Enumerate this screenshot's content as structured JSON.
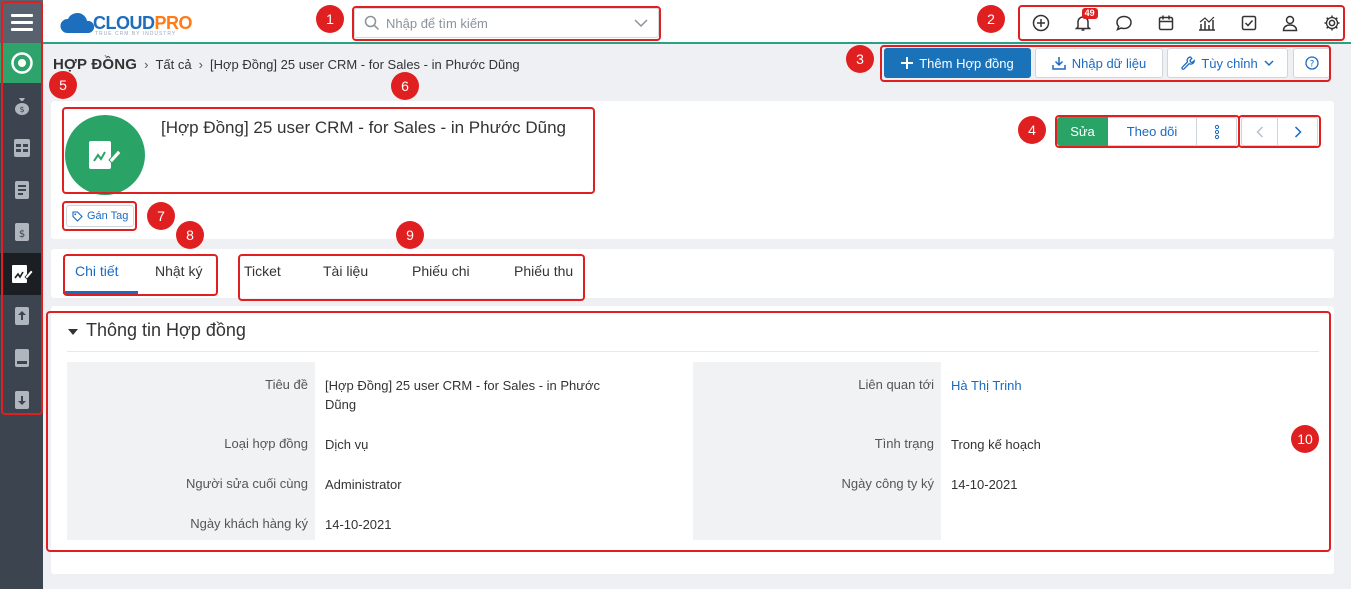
{
  "app": {
    "logo_main": "CLOUD",
    "logo_accent": "PRO",
    "logo_tagline": "TRUE CRM BY INDUSTRY"
  },
  "search": {
    "placeholder": "Nhập để tìm kiếm"
  },
  "notifications": {
    "count": "49"
  },
  "top_icons": [
    "plus-circle-icon",
    "bell-icon",
    "chat-icon",
    "calendar-icon",
    "chart-icon",
    "checkbox-icon",
    "user-icon",
    "gear-icon"
  ],
  "sidebar": {
    "icons": [
      "menu-icon",
      "home-icon",
      "money-bag-icon",
      "spreadsheet-icon",
      "document-icon",
      "invoice-icon",
      "contract-icon",
      "upload-icon",
      "book-icon",
      "download-icon"
    ],
    "active": "contract-icon"
  },
  "breadcrumb": {
    "module": "HỢP ĐỒNG",
    "all": "Tất cả",
    "record": "[Hợp Đồng] 25 user CRM - for Sales - in Phước Dũng"
  },
  "toolbar": {
    "add_label": "Thêm Hợp đồng",
    "import_label": "Nhập dữ liệu",
    "customize_label": "Tùy chỉnh"
  },
  "record": {
    "title": "[Hợp Đồng] 25 user CRM - for Sales - in Phước Dũng",
    "tag_label": "Gán Tag",
    "edit_label": "Sửa",
    "follow_label": "Theo dõi"
  },
  "tabs": {
    "group1": [
      "Chi tiết",
      "Nhật ký"
    ],
    "group2": [
      "Ticket",
      "Tài liệu",
      "Phiếu chi",
      "Phiếu thu"
    ],
    "active": "Chi tiết"
  },
  "details": {
    "section_title": "Thông tin Hợp đồng",
    "left": [
      {
        "label": "Tiêu đề",
        "value": "[Hợp Đồng] 25 user CRM - for Sales - in Phước Dũng"
      },
      {
        "label": "Loại hợp đồng",
        "value": "Dịch vụ"
      },
      {
        "label": "Người sửa cuối cùng",
        "value": "Administrator"
      },
      {
        "label": "Ngày khách hàng ký",
        "value": "14-10-2021"
      }
    ],
    "right": [
      {
        "label": "Liên quan tới",
        "value": "Hà Thị Trinh"
      },
      {
        "label": "Tình trạng",
        "value": "Trong kế hoạch"
      },
      {
        "label": "Ngày công ty ký",
        "value": "14-10-2021"
      }
    ]
  },
  "annotations": [
    "1",
    "2",
    "3",
    "4",
    "5",
    "6",
    "7",
    "8",
    "9",
    "10"
  ],
  "colors": {
    "accent_green": "#2aa366",
    "primary_blue": "#1a73b9",
    "annotation_red": "#e02020",
    "sidebar_dark": "#3c4450"
  }
}
